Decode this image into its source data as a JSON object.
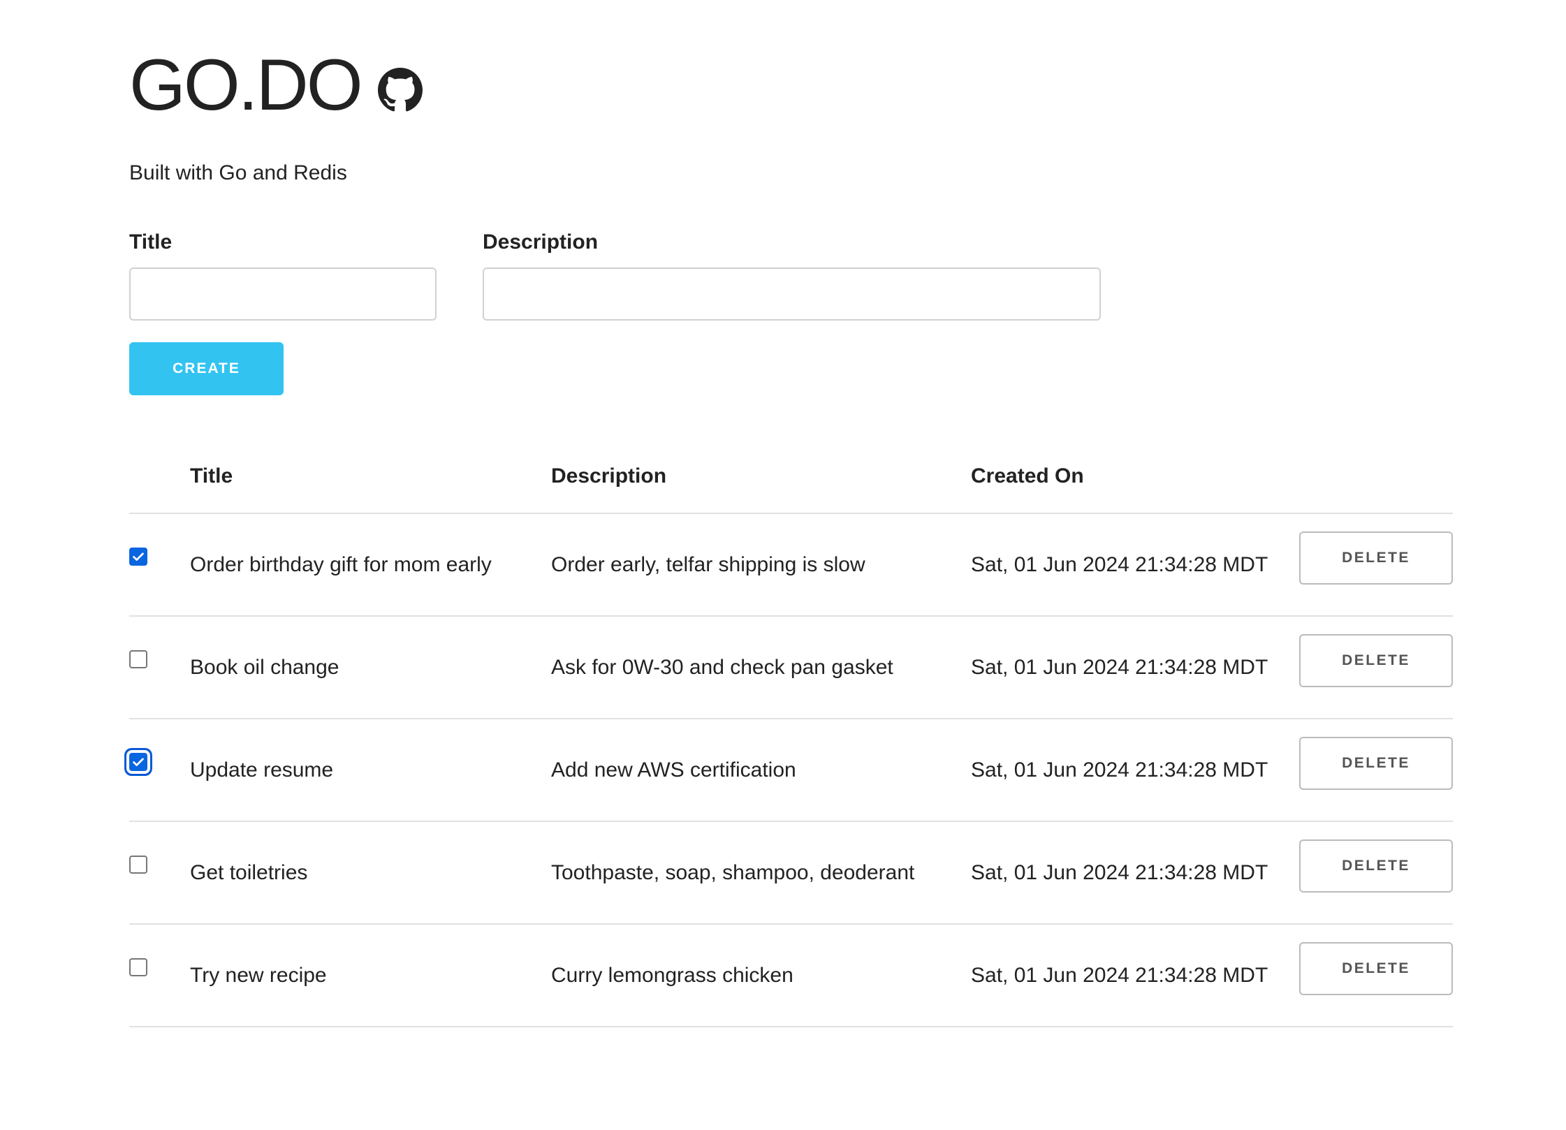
{
  "app": {
    "title": "GO.DO",
    "github_icon": "github-icon",
    "subtitle": "Built with Go and Redis"
  },
  "form": {
    "title_label": "Title",
    "title_value": "",
    "description_label": "Description",
    "description_value": "",
    "create_label": "CREATE"
  },
  "colors": {
    "accent": "#33c3f0",
    "checkbox_checked": "#0a66e0",
    "border": "#e1e1e1",
    "text": "#222222"
  },
  "table": {
    "headers": {
      "title": "Title",
      "description": "Description",
      "created_on": "Created On"
    },
    "rows": [
      {
        "done": true,
        "title": "Order birthday gift for mom early",
        "description": "Order early, telfar shipping is slow",
        "created_on": "Sat, 01 Jun 2024 21:34:28 MDT",
        "delete_label": "DELETE"
      },
      {
        "done": false,
        "title": "Book oil change",
        "description": "Ask for 0W-30 and check pan gasket",
        "created_on": "Sat, 01 Jun 2024 21:34:28 MDT",
        "delete_label": "DELETE"
      },
      {
        "done": true,
        "focused": true,
        "title": "Update resume",
        "description": "Add new AWS certification",
        "created_on": "Sat, 01 Jun 2024 21:34:28 MDT",
        "delete_label": "DELETE"
      },
      {
        "done": false,
        "title": "Get toiletries",
        "description": "Toothpaste, soap, shampoo, deoderant",
        "created_on": "Sat, 01 Jun 2024 21:34:28 MDT",
        "delete_label": "DELETE"
      },
      {
        "done": false,
        "title": "Try new recipe",
        "description": "Curry lemongrass chicken",
        "created_on": "Sat, 01 Jun 2024 21:34:28 MDT",
        "delete_label": "DELETE"
      }
    ]
  }
}
